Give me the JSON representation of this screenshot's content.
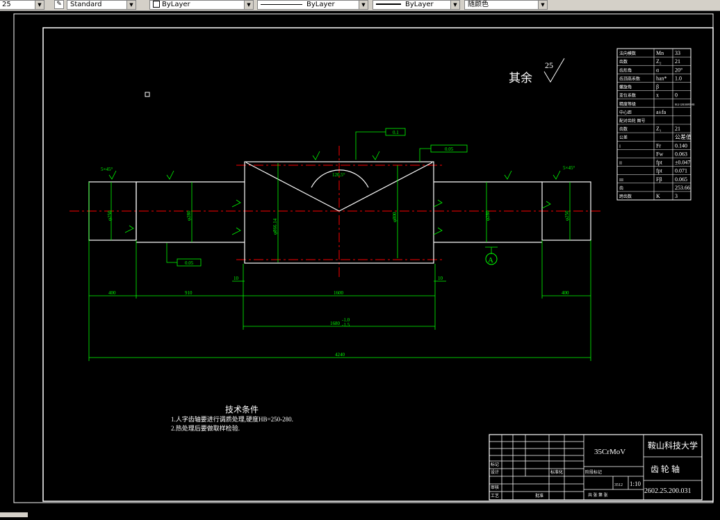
{
  "toolbar": {
    "first_combo": "25",
    "text_style": "Standard",
    "layer": "ByLayer",
    "linetype": "ByLayer",
    "lineweight": "ByLayer",
    "plot_style": "随颜色"
  },
  "drawing": {
    "roughness_note": "其余",
    "roughness_value": "25",
    "tech_title": "技术条件",
    "tech_line1": "1.人字齿轴要进行调质处理,硬度HB=250-280.",
    "tech_line2": "2.热处理后要做取样检验.",
    "dims": {
      "d400l": "400",
      "d910": "910",
      "d1600": "1600",
      "d400r": "400",
      "d4240": "4240",
      "d10l": "10",
      "d10r": "10",
      "tol_main": "1680",
      "tol_up": "-1.0",
      "tol_low": "-1.5",
      "angle": "120.5°",
      "chamfer_r": "5×45°",
      "gap": "20",
      "diam_mid": "φ866.14",
      "diam_lower": "φ800",
      "diam_left": "φ280",
      "diam_right": "φ280",
      "diam_end_l": "φ250",
      "diam_end_r": "φ250"
    },
    "datum": "A",
    "gdt1": "0.05",
    "gdt2": "0.1",
    "gdt3": "0.05",
    "gdt_bottom": "0.05"
  },
  "param_table": {
    "rows": [
      {
        "label": "法向模数",
        "sym": "Mn",
        "val": "33"
      },
      {
        "label": "齿数",
        "sym": "Z₂",
        "val": "21"
      },
      {
        "label": "齿形角",
        "sym": "α",
        "val": "20°"
      },
      {
        "label": "齿顶高系数",
        "sym": "han*",
        "val": "1.0"
      },
      {
        "label": "螺旋角",
        "sym": "β",
        "val": ""
      },
      {
        "label": "变位系数",
        "sym": "x",
        "val": "0"
      },
      {
        "label": "精度等级",
        "sym": "",
        "val": "8GJ GB10095-88"
      },
      {
        "label": "中心距",
        "sym": "a±fa",
        "val": ""
      },
      {
        "label": "配对齿轮 图号",
        "sym": "",
        "val": ""
      },
      {
        "label": "齿数",
        "sym": "Z₁",
        "val": "21"
      },
      {
        "label": "公差",
        "sym": "",
        "val": "公差值"
      },
      {
        "label": "I",
        "sym": "Fr",
        "val": "0.140"
      },
      {
        "label": "",
        "sym": "Fw",
        "val": "0.063"
      },
      {
        "label": "II",
        "sym": "fpt",
        "val": "±0.047"
      },
      {
        "label": "",
        "sym": "fpt",
        "val": "0.071"
      },
      {
        "label": "III",
        "sym": "Fβ",
        "val": "0.065"
      },
      {
        "label": "齿",
        "sym": "",
        "val": "253.66"
      },
      {
        "label": "跨齿数",
        "sym": "K",
        "val": "3"
      }
    ]
  },
  "title_block": {
    "material": "35CrMoV",
    "school": "鞍山科技大学",
    "part_name": "齿 轮 轴",
    "drawing_no": "2602.25.200.031",
    "scale": "1:10",
    "weight": "3512",
    "row_labels": [
      "标记",
      "设计",
      "审核",
      "工艺"
    ],
    "approve": "批准",
    "standard": "标准化",
    "stage": "阶段标记",
    "sheets": "共 张 第 张"
  }
}
